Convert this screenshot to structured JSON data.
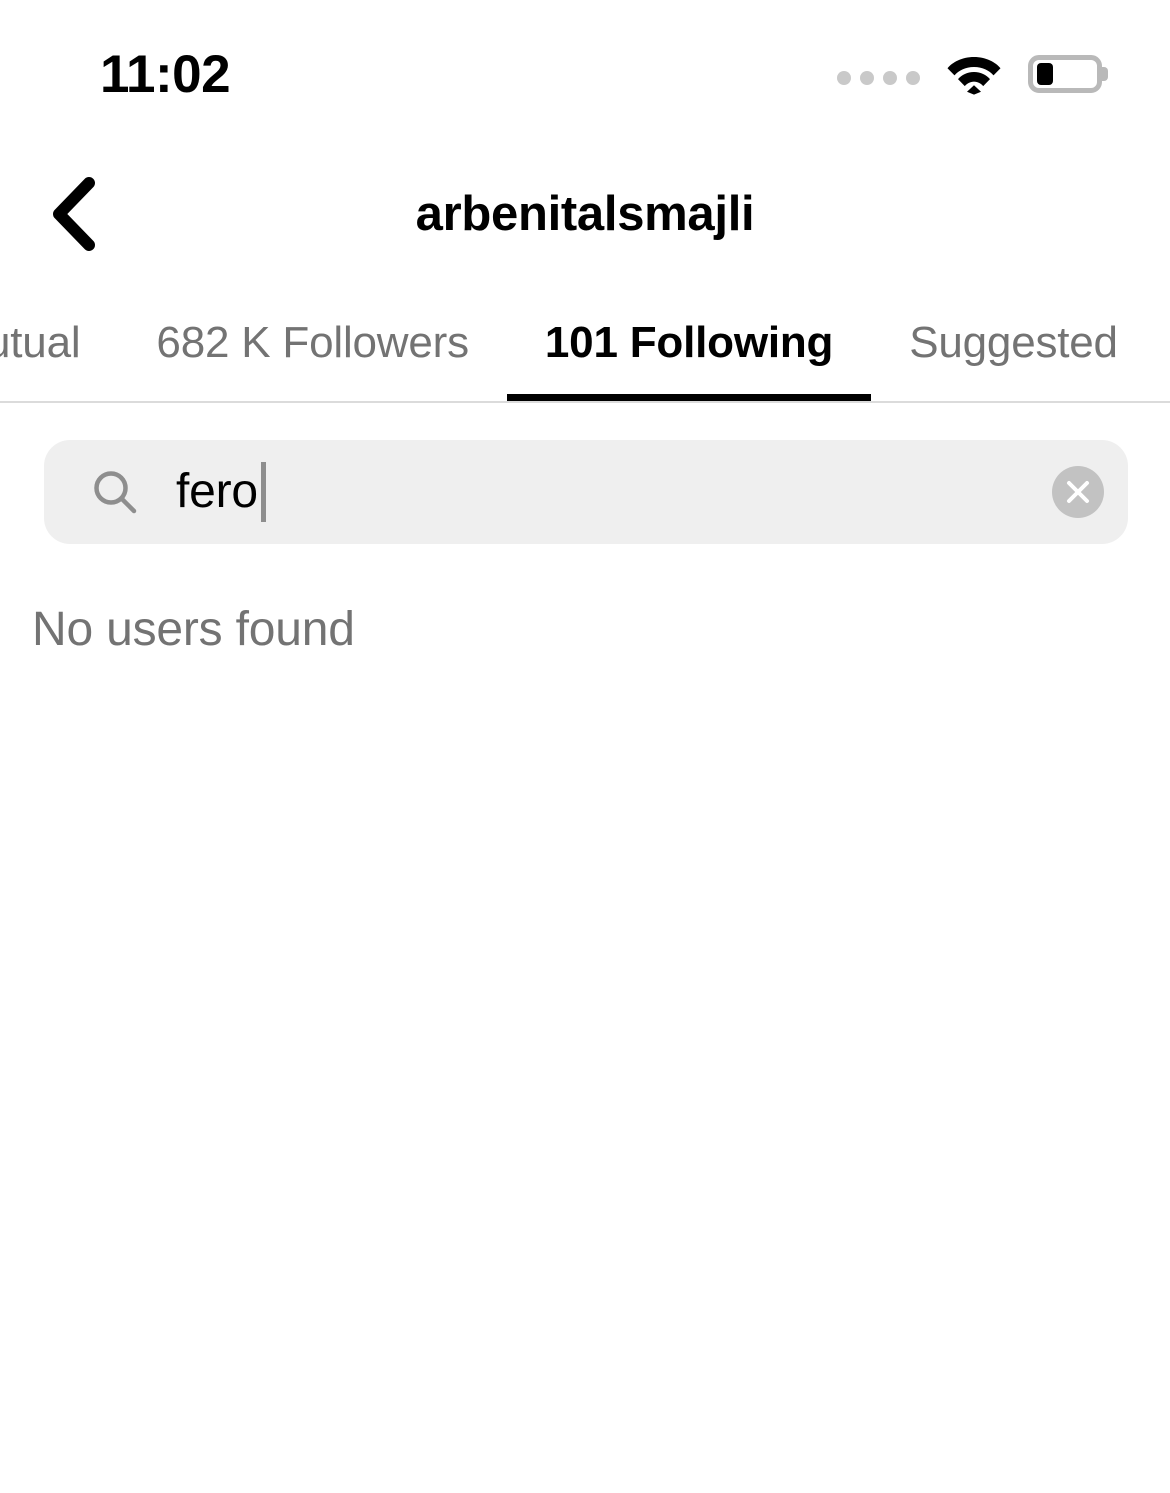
{
  "status_bar": {
    "time": "11:02",
    "cellular_icon": "signal-dots-icon",
    "wifi_icon": "wifi-icon",
    "battery_icon": "battery-icon",
    "battery_level_percent": 28
  },
  "nav": {
    "back_icon": "chevron-left-icon",
    "title": "arbenitalsmajli"
  },
  "tabs": [
    {
      "label": "utual",
      "active": false,
      "name": "tab-mutual"
    },
    {
      "label": "682 K Followers",
      "active": false,
      "name": "tab-followers"
    },
    {
      "label": "101 Following",
      "active": true,
      "name": "tab-following"
    },
    {
      "label": "Suggested",
      "active": false,
      "name": "tab-suggested"
    }
  ],
  "search": {
    "icon": "search-icon",
    "value": "fero",
    "placeholder": "Search",
    "clear_icon": "close-circle-icon"
  },
  "results": {
    "empty_message": "No users found"
  },
  "colors": {
    "background": "#ffffff",
    "primary_text": "#000000",
    "secondary_text": "#737373",
    "search_field_bg": "#efefef",
    "clear_button_bg": "#c2c2c2",
    "divider": "#dbdbdb",
    "active_indicator": "#000000"
  }
}
